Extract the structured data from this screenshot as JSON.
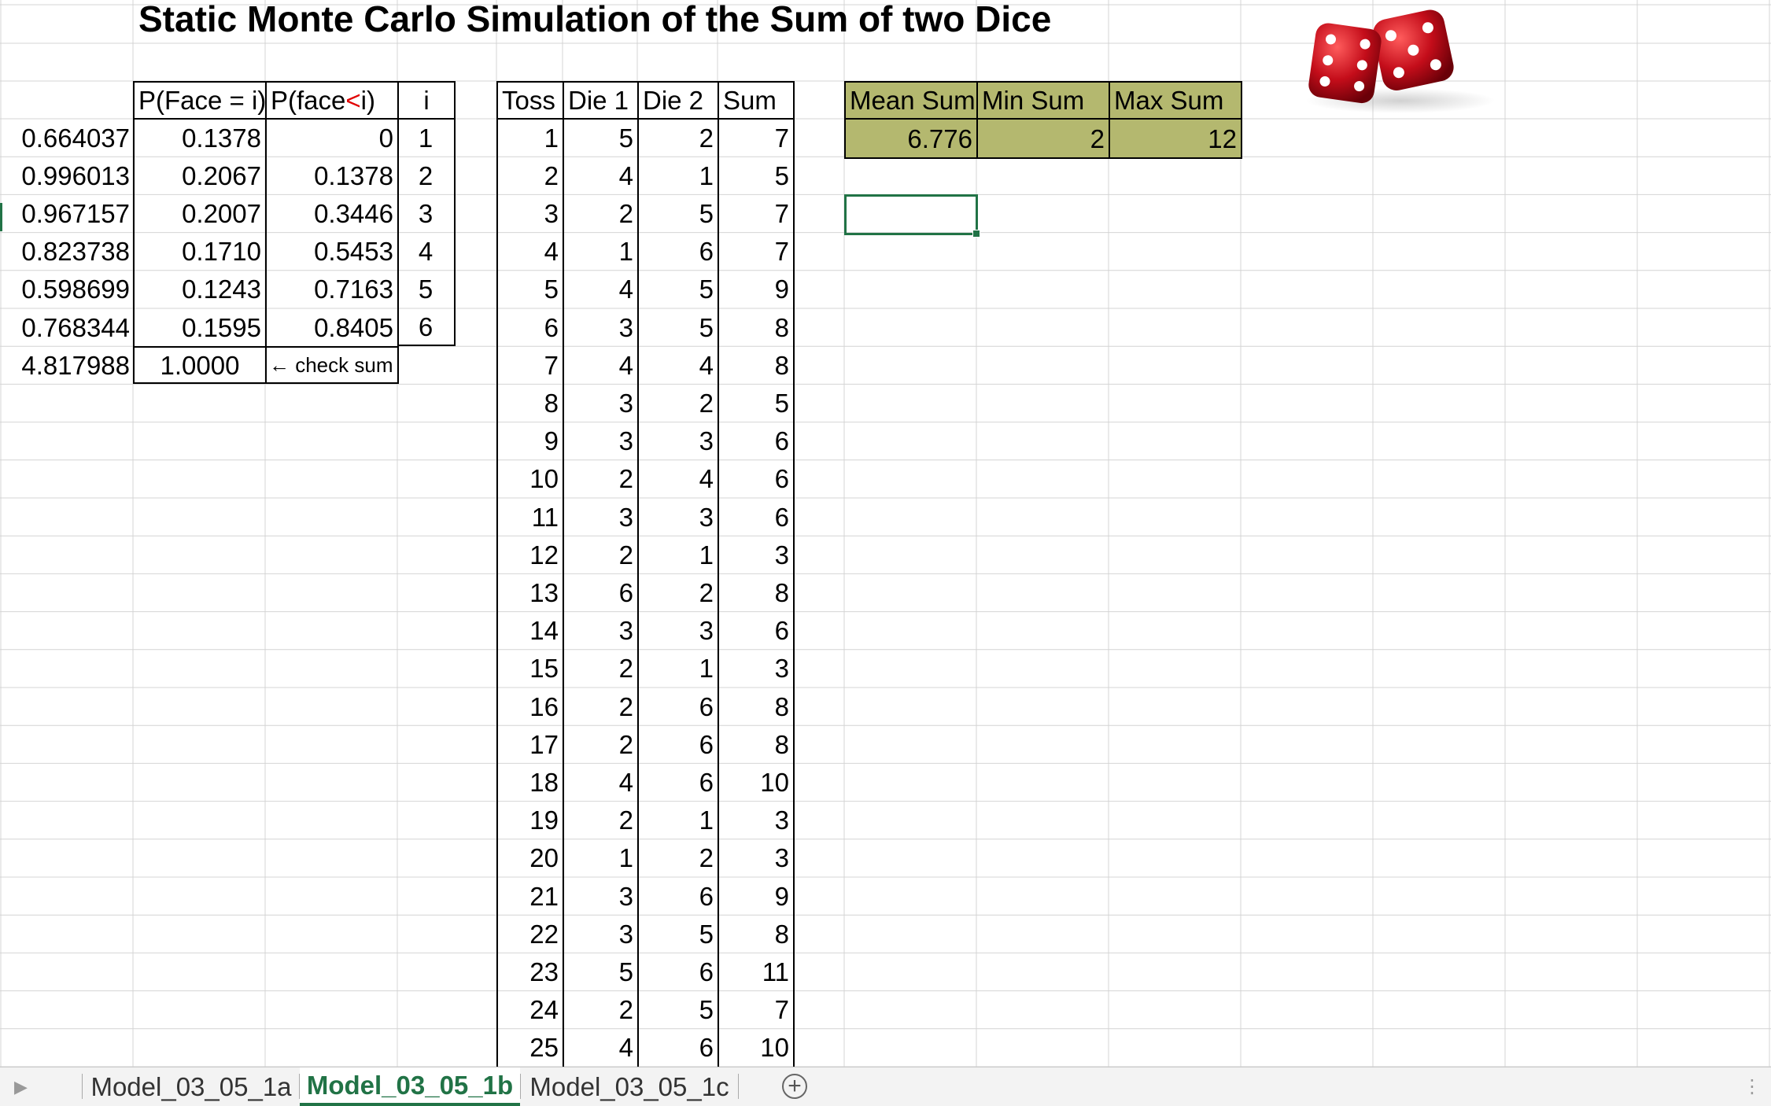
{
  "title": "Static Monte Carlo Simulation of the Sum of two Dice",
  "prob_table": {
    "headers": {
      "p_face": "P(Face = i)",
      "p_less_a": "P(face ",
      "p_less_lt": "<",
      "p_less_b": " i)",
      "i": "i"
    },
    "rows": [
      {
        "rand": "0.664037",
        "p_face": "0.1378",
        "p_less": "0",
        "i": "1"
      },
      {
        "rand": "0.996013",
        "p_face": "0.2067",
        "p_less": "0.1378",
        "i": "2"
      },
      {
        "rand": "0.967157",
        "p_face": "0.2007",
        "p_less": "0.3446",
        "i": "3"
      },
      {
        "rand": "0.823738",
        "p_face": "0.1710",
        "p_less": "0.5453",
        "i": "4"
      },
      {
        "rand": "0.598699",
        "p_face": "0.1243",
        "p_less": "0.7163",
        "i": "5"
      },
      {
        "rand": "0.768344",
        "p_face": "0.1595",
        "p_less": "0.8405",
        "i": "6"
      }
    ],
    "sum_row": {
      "rand": "4.817988",
      "p_face": "1.0000",
      "note": "← check sum"
    }
  },
  "toss_table": {
    "headers": [
      "Toss",
      "Die 1",
      "Die 2",
      "Sum"
    ],
    "rows": [
      [
        "1",
        "5",
        "2",
        "7"
      ],
      [
        "2",
        "4",
        "1",
        "5"
      ],
      [
        "3",
        "2",
        "5",
        "7"
      ],
      [
        "4",
        "1",
        "6",
        "7"
      ],
      [
        "5",
        "4",
        "5",
        "9"
      ],
      [
        "6",
        "3",
        "5",
        "8"
      ],
      [
        "7",
        "4",
        "4",
        "8"
      ],
      [
        "8",
        "3",
        "2",
        "5"
      ],
      [
        "9",
        "3",
        "3",
        "6"
      ],
      [
        "10",
        "2",
        "4",
        "6"
      ],
      [
        "11",
        "3",
        "3",
        "6"
      ],
      [
        "12",
        "2",
        "1",
        "3"
      ],
      [
        "13",
        "6",
        "2",
        "8"
      ],
      [
        "14",
        "3",
        "3",
        "6"
      ],
      [
        "15",
        "2",
        "1",
        "3"
      ],
      [
        "16",
        "2",
        "6",
        "8"
      ],
      [
        "17",
        "2",
        "6",
        "8"
      ],
      [
        "18",
        "4",
        "6",
        "10"
      ],
      [
        "19",
        "2",
        "1",
        "3"
      ],
      [
        "20",
        "1",
        "2",
        "3"
      ],
      [
        "21",
        "3",
        "6",
        "9"
      ],
      [
        "22",
        "3",
        "5",
        "8"
      ],
      [
        "23",
        "5",
        "6",
        "11"
      ],
      [
        "24",
        "2",
        "5",
        "7"
      ],
      [
        "25",
        "4",
        "6",
        "10"
      ]
    ]
  },
  "stats": {
    "headers": [
      "Mean Sum",
      "Min Sum",
      "Max Sum"
    ],
    "values": [
      "6.776",
      "2",
      "12"
    ],
    "fill_color": "#b4b86f"
  },
  "sheet_tabs": [
    {
      "label": "Model_03_05_1a",
      "active": false
    },
    {
      "label": "Model_03_05_1b",
      "active": true
    },
    {
      "label": "Model_03_05_1c",
      "active": false
    }
  ],
  "accent_color": "#217346",
  "dice_image": "red-dice-icon"
}
